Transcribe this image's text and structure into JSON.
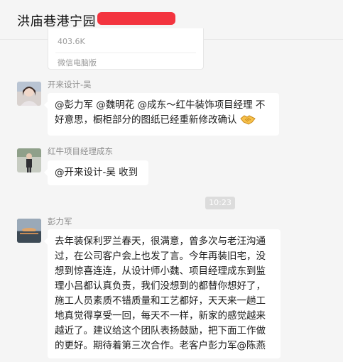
{
  "header": {
    "title": "洪庙巷港宁园"
  },
  "file_card": {
    "size": "403.6K",
    "source": "微信电脑版"
  },
  "messages": [
    {
      "sender": "开来设计-吴",
      "text": "@彭力军 @魏明花 @成东～红牛装饰项目经理 不好意思，橱柜部分的图纸已经重新修改确认",
      "emoji": "handshake-icon"
    },
    {
      "sender": "红牛项目经理成东",
      "text": "@开来设计-吴 收到"
    },
    {
      "sender": "彭力军",
      "text": "去年装保利罗兰春天，很满意，曾多次与老汪沟通过，在公司客户会上也发了言。今年再装旧宅，没想到惊喜连连，从设计师小魏、项目经理成东到监理小吕都认真负责，我们没想到的都替你想好了，施工人员素质不错质量和工艺都好，天天来一趟工地真觉得享受一回，每天不一样，新家的感觉越来越近了。建议给这个团队表扬鼓励，把下面工作做的更好。期待着第三次合作。老客户彭力军@陈燕"
    }
  ],
  "timestamp": "10:23"
}
